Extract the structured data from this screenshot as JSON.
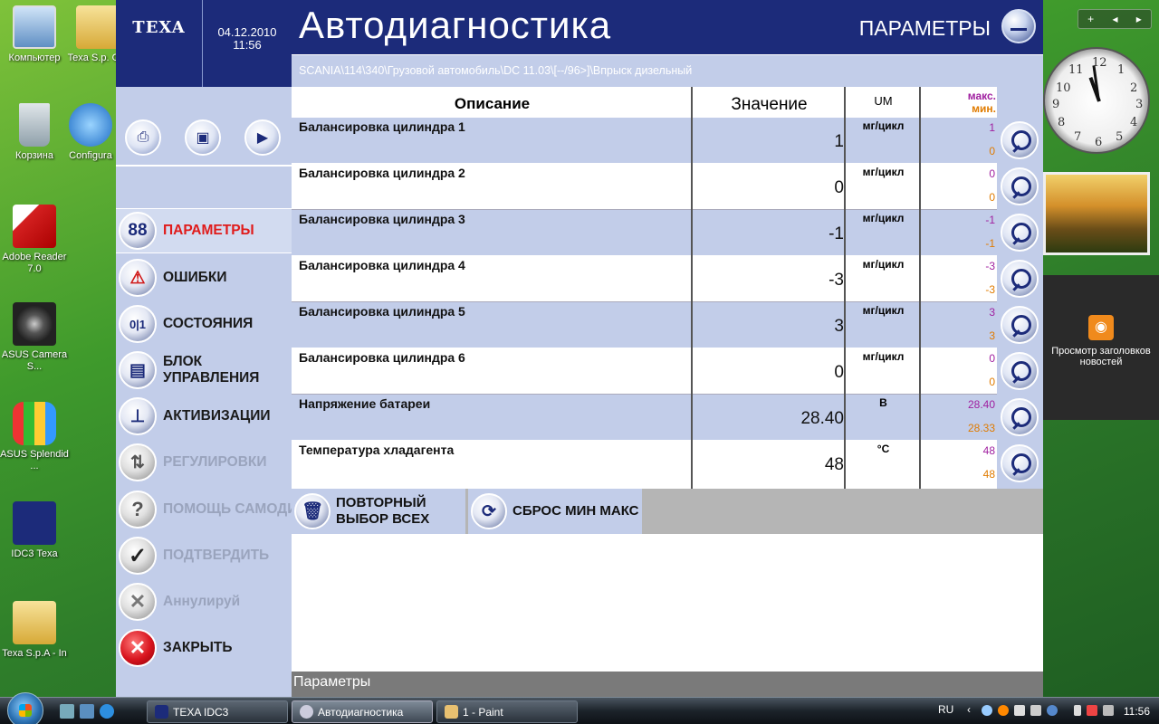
{
  "desktop": {
    "icons": [
      {
        "label": "Компьютер"
      },
      {
        "label": "Texa S.p. Out"
      },
      {
        "label": "Корзина"
      },
      {
        "label": "Configura"
      },
      {
        "label": "Adobe Reader 7.0"
      },
      {
        "label": "ASUS Camera S..."
      },
      {
        "label": "ASUS Splendid ..."
      },
      {
        "label": "IDC3 Texa"
      },
      {
        "label": "Texa S.p.A - In"
      }
    ],
    "gadget_bar": {
      "add": "+",
      "prev": "◂",
      "next": "▸"
    },
    "clock_numbers": [
      "12",
      "1",
      "2",
      "3",
      "4",
      "5",
      "6",
      "7",
      "8",
      "9",
      "10",
      "11"
    ],
    "rss_label": "Просмотр заголовков новостей"
  },
  "app": {
    "logo": "TEXA",
    "date": "04.12.2010",
    "time": "11:56",
    "title": "Автодиагностика",
    "section": "ПАРАМЕТРЫ",
    "breadcrumb": "SCANIA\\114\\340\\Грузовой автомобиль\\DC 11.03\\[--/96>]\\Впрыск дизельный",
    "nav": [
      {
        "label": "ПАРАМЕТРЫ",
        "icon": "88"
      },
      {
        "label": "ОШИБКИ",
        "icon": "⚠"
      },
      {
        "label": "СОСТОЯНИЯ",
        "icon": "0|1"
      },
      {
        "label": "БЛОК УПРАВЛЕНИЯ",
        "icon": "▤"
      },
      {
        "label": "АКТИВИЗАЦИИ",
        "icon": "⊥"
      },
      {
        "label": "РЕГУЛИРОВКИ",
        "icon": "⇅"
      },
      {
        "label": "ПОМОЩЬ САМОДИАГНОСТ",
        "icon": "?"
      },
      {
        "label": "ПОДТВЕРДИТЬ",
        "icon": "✓"
      },
      {
        "label": "Аннулируй",
        "icon": "✕"
      },
      {
        "label": "ЗАКРЫТЬ",
        "icon": "✕"
      }
    ],
    "table": {
      "headers": {
        "description": "Описание",
        "value": "Значение",
        "um": "UM",
        "max": "макс.",
        "min": "мин."
      },
      "rows": [
        {
          "description": "Балансировка цилиндра 1",
          "value": "1",
          "um": "мг/цикл",
          "max": "1",
          "min": "0"
        },
        {
          "description": "Балансировка цилиндра 2",
          "value": "0",
          "um": "мг/цикл",
          "max": "0",
          "min": "0"
        },
        {
          "description": "Балансировка цилиндра 3",
          "value": "-1",
          "um": "мг/цикл",
          "max": "-1",
          "min": "-1"
        },
        {
          "description": "Балансировка цилиндра 4",
          "value": "-3",
          "um": "мг/цикл",
          "max": "-3",
          "min": "-3"
        },
        {
          "description": "Балансировка цилиндра 5",
          "value": "3",
          "um": "мг/цикл",
          "max": "3",
          "min": "3"
        },
        {
          "description": "Балансировка цилиндра 6",
          "value": "0",
          "um": "мг/цикл",
          "max": "0",
          "min": "0"
        },
        {
          "description": "Напряжение батареи",
          "value": "28.40",
          "um": "В",
          "max": "28.40",
          "min": "28.33"
        },
        {
          "description": "Температура хладагента",
          "value": "48",
          "um": "°C",
          "max": "48",
          "min": "48"
        }
      ]
    },
    "actions": {
      "reselect": "ПОВТОРНЫЙ ВЫБОР ВСЕХ",
      "reset": "СБРОС МИН МАКС"
    },
    "status": "Параметры"
  },
  "taskbar": {
    "tasks": [
      {
        "label": "TEXA IDC3"
      },
      {
        "label": "Автодиагностика"
      },
      {
        "label": "1 - Paint"
      }
    ],
    "lang": "RU",
    "time": "11:56"
  }
}
